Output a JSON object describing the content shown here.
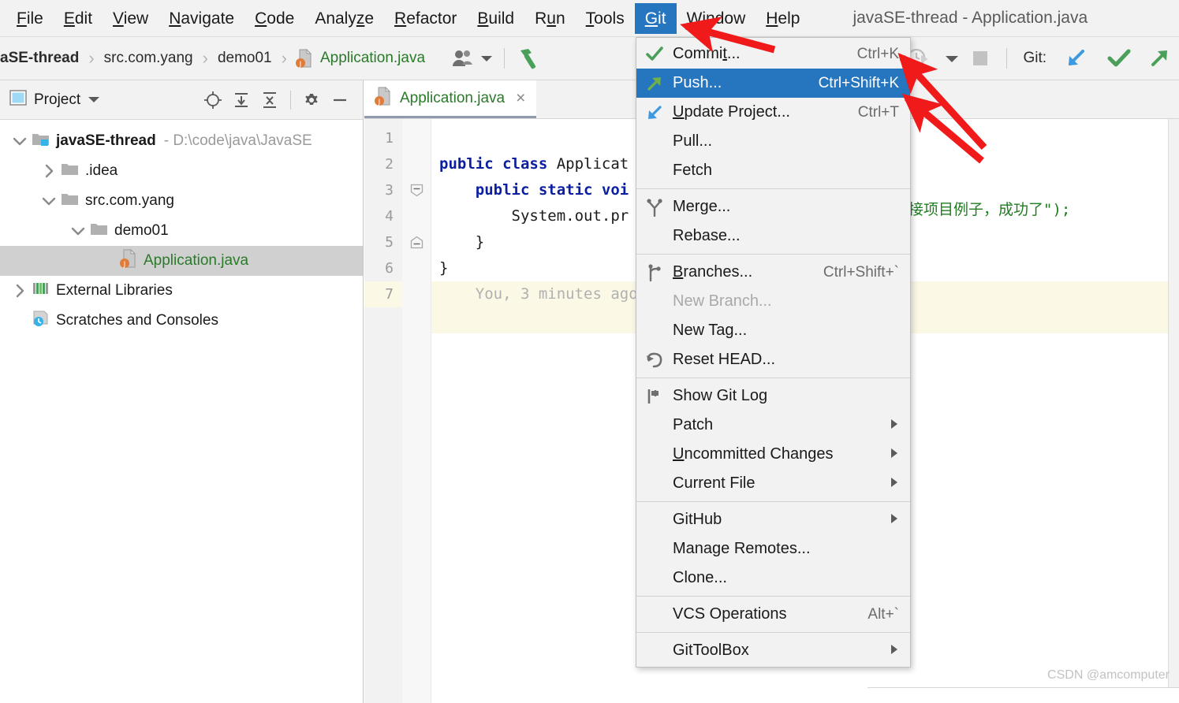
{
  "window": {
    "title": "javaSE-thread - Application.java"
  },
  "menubar": {
    "items": [
      {
        "label": "File",
        "mnemonic": "F",
        "active": false
      },
      {
        "label": "Edit",
        "mnemonic": "E",
        "active": false
      },
      {
        "label": "View",
        "mnemonic": "V",
        "active": false
      },
      {
        "label": "Navigate",
        "mnemonic": "N",
        "active": false
      },
      {
        "label": "Code",
        "mnemonic": "C",
        "active": false
      },
      {
        "label": "Analyze",
        "mnemonic": "z",
        "active": false
      },
      {
        "label": "Refactor",
        "mnemonic": "R",
        "active": false
      },
      {
        "label": "Build",
        "mnemonic": "B",
        "active": false
      },
      {
        "label": "Run",
        "mnemonic": "u",
        "active": false
      },
      {
        "label": "Tools",
        "mnemonic": "T",
        "active": false
      },
      {
        "label": "Git",
        "mnemonic": "G",
        "active": true
      },
      {
        "label": "Window",
        "mnemonic": "W",
        "active": false
      },
      {
        "label": "Help",
        "mnemonic": "H",
        "active": false
      }
    ]
  },
  "toolbar": {
    "breadcrumbs": [
      "aSE-thread",
      "src.com.yang",
      "demo01",
      "Application.java"
    ],
    "separator": "›",
    "git_label": "Git:",
    "icons": [
      "user-avatar-icon",
      "chevron-down-icon",
      "build-hammer-icon",
      "run-with-coverage-icon",
      "chevron-down-icon",
      "stop-icon",
      "git-update-icon",
      "git-commit-icon",
      "git-push-icon"
    ]
  },
  "project_panel": {
    "title": "Project",
    "header_icons": [
      "locate-icon",
      "expand-all-icon",
      "collapse-all-icon",
      "gear-icon",
      "minimize-icon"
    ],
    "tree": [
      {
        "label": "javaSE-thread",
        "path": "- D:\\code\\java\\JavaSE",
        "depth": 0,
        "twisty": "down",
        "icon": "module-folder-icon",
        "bold": true,
        "selected": false,
        "green": false
      },
      {
        "label": ".idea",
        "path": "",
        "depth": 1,
        "twisty": "right",
        "icon": "folder-icon",
        "bold": false,
        "selected": false,
        "green": false
      },
      {
        "label": "src.com.yang",
        "path": "",
        "depth": 1,
        "twisty": "down",
        "icon": "folder-icon",
        "bold": false,
        "selected": false,
        "green": false
      },
      {
        "label": "demo01",
        "path": "",
        "depth": 2,
        "twisty": "down",
        "icon": "folder-icon",
        "bold": false,
        "selected": false,
        "green": false
      },
      {
        "label": "Application.java",
        "path": "",
        "depth": 3,
        "twisty": "none",
        "icon": "java-class-icon",
        "bold": false,
        "selected": true,
        "green": true
      },
      {
        "label": "External Libraries",
        "path": "",
        "depth": 0,
        "twisty": "right",
        "icon": "libraries-icon",
        "bold": false,
        "selected": false,
        "green": false
      },
      {
        "label": "Scratches and Consoles",
        "path": "",
        "depth": 0,
        "twisty": "none",
        "icon": "scratches-icon",
        "bold": false,
        "selected": false,
        "green": false
      }
    ]
  },
  "editor": {
    "tab": {
      "label": "Application.java",
      "close": "×",
      "icon": "java-class-icon"
    },
    "line_numbers": [
      "1",
      "2",
      "3",
      "4",
      "5",
      "6",
      "7"
    ],
    "code_lines": [
      {
        "n": "1",
        "segments": [],
        "highlight": false
      },
      {
        "n": "2",
        "segments": [
          {
            "t": "public class ",
            "c": "kw"
          },
          {
            "t": "Applicat",
            "c": "plain"
          }
        ],
        "highlight": false
      },
      {
        "n": "3",
        "segments": [
          {
            "t": "    ",
            "c": "plain"
          },
          {
            "t": "public static voi",
            "c": "kw"
          }
        ],
        "highlight": false
      },
      {
        "n": "4",
        "segments": [
          {
            "t": "        System.out.pr",
            "c": "plain"
          }
        ],
        "highlight": false
      },
      {
        "n": "5",
        "segments": [
          {
            "t": "    }",
            "c": "plain"
          }
        ],
        "highlight": false
      },
      {
        "n": "6",
        "segments": [
          {
            "t": "}",
            "c": "plain"
          }
        ],
        "highlight": false
      },
      {
        "n": "7",
        "segments": [
          {
            "t": "    You, 3 minutes ago",
            "c": "hint"
          }
        ],
        "highlight": true
      }
    ],
    "chinese_string_fragment": "接项目例子，成功了\");"
  },
  "git_menu": {
    "groups": [
      {
        "items": [
          {
            "label": "Commit...",
            "shortcut": "Ctrl+K",
            "icon": "check-green-icon",
            "selected": false,
            "disabled": false,
            "submenu": false,
            "mnemonic": "t"
          },
          {
            "label": "Push...",
            "shortcut": "Ctrl+Shift+K",
            "icon": "arrow-up-right-green-icon",
            "selected": true,
            "disabled": false,
            "submenu": false,
            "mnemonic": ""
          },
          {
            "label": "Update Project...",
            "shortcut": "Ctrl+T",
            "icon": "arrow-down-left-blue-icon",
            "selected": false,
            "disabled": false,
            "submenu": false,
            "mnemonic": "U"
          },
          {
            "label": "Pull...",
            "shortcut": "",
            "icon": "",
            "selected": false,
            "disabled": false,
            "submenu": false,
            "mnemonic": ""
          },
          {
            "label": "Fetch",
            "shortcut": "",
            "icon": "",
            "selected": false,
            "disabled": false,
            "submenu": false,
            "mnemonic": ""
          }
        ]
      },
      {
        "items": [
          {
            "label": "Merge...",
            "shortcut": "",
            "icon": "merge-icon",
            "selected": false,
            "disabled": false,
            "submenu": false,
            "mnemonic": ""
          },
          {
            "label": "Rebase...",
            "shortcut": "",
            "icon": "",
            "selected": false,
            "disabled": false,
            "submenu": false,
            "mnemonic": ""
          }
        ]
      },
      {
        "items": [
          {
            "label": "Branches...",
            "shortcut": "Ctrl+Shift+`",
            "icon": "branch-icon",
            "selected": false,
            "disabled": false,
            "submenu": false,
            "mnemonic": "B"
          },
          {
            "label": "New Branch...",
            "shortcut": "",
            "icon": "",
            "selected": false,
            "disabled": true,
            "submenu": false,
            "mnemonic": ""
          },
          {
            "label": "New Tag...",
            "shortcut": "",
            "icon": "",
            "selected": false,
            "disabled": false,
            "submenu": false,
            "mnemonic": ""
          },
          {
            "label": "Reset HEAD...",
            "shortcut": "",
            "icon": "reset-undo-icon",
            "selected": false,
            "disabled": false,
            "submenu": false,
            "mnemonic": ""
          }
        ]
      },
      {
        "items": [
          {
            "label": "Show Git Log",
            "shortcut": "",
            "icon": "git-log-icon",
            "selected": false,
            "disabled": false,
            "submenu": false,
            "mnemonic": ""
          },
          {
            "label": "Patch",
            "shortcut": "",
            "icon": "",
            "selected": false,
            "disabled": false,
            "submenu": true,
            "mnemonic": ""
          },
          {
            "label": "Uncommitted Changes",
            "shortcut": "",
            "icon": "",
            "selected": false,
            "disabled": false,
            "submenu": true,
            "mnemonic": "U"
          },
          {
            "label": "Current File",
            "shortcut": "",
            "icon": "",
            "selected": false,
            "disabled": false,
            "submenu": true,
            "mnemonic": ""
          }
        ]
      },
      {
        "items": [
          {
            "label": "GitHub",
            "shortcut": "",
            "icon": "",
            "selected": false,
            "disabled": false,
            "submenu": true,
            "mnemonic": ""
          },
          {
            "label": "Manage Remotes...",
            "shortcut": "",
            "icon": "",
            "selected": false,
            "disabled": false,
            "submenu": false,
            "mnemonic": ""
          },
          {
            "label": "Clone...",
            "shortcut": "",
            "icon": "",
            "selected": false,
            "disabled": false,
            "submenu": false,
            "mnemonic": ""
          }
        ]
      },
      {
        "items": [
          {
            "label": "VCS Operations",
            "shortcut": "Alt+`",
            "icon": "",
            "selected": false,
            "disabled": false,
            "submenu": false,
            "mnemonic": ""
          }
        ]
      },
      {
        "items": [
          {
            "label": "GitToolBox",
            "shortcut": "",
            "icon": "",
            "selected": false,
            "disabled": false,
            "submenu": true,
            "mnemonic": ""
          }
        ]
      }
    ]
  },
  "annotations": {
    "arrow_color": "#f01a1a",
    "arrows": [
      "arrow-pointing-git-menu",
      "arrow-pointing-commit-row",
      "arrow-pointing-push-row"
    ]
  },
  "watermark": {
    "text": "CSDN @amcomputer"
  },
  "colors": {
    "accent_blue": "#2675bf",
    "chrome_gray": "#f2f2f2",
    "green_text": "#2a7a2a",
    "keyword_blue": "#0b1fa0",
    "highlight_line": "#fcf8e6",
    "annotation_red": "#f01a1a"
  }
}
